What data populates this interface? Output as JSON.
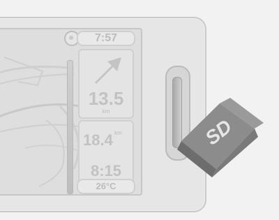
{
  "display": {
    "clock": "7:57",
    "next_turn_distance": "13.5",
    "next_turn_unit": "km",
    "remaining_distance": "18.4",
    "remaining_unit": "km",
    "eta": "8:15",
    "temperature": "26°C"
  },
  "sd_card": {
    "label": "SD"
  },
  "icons": {
    "compass": "compass-icon",
    "turn": "arrow-up-right-icon",
    "card": "sd-card-icon"
  }
}
